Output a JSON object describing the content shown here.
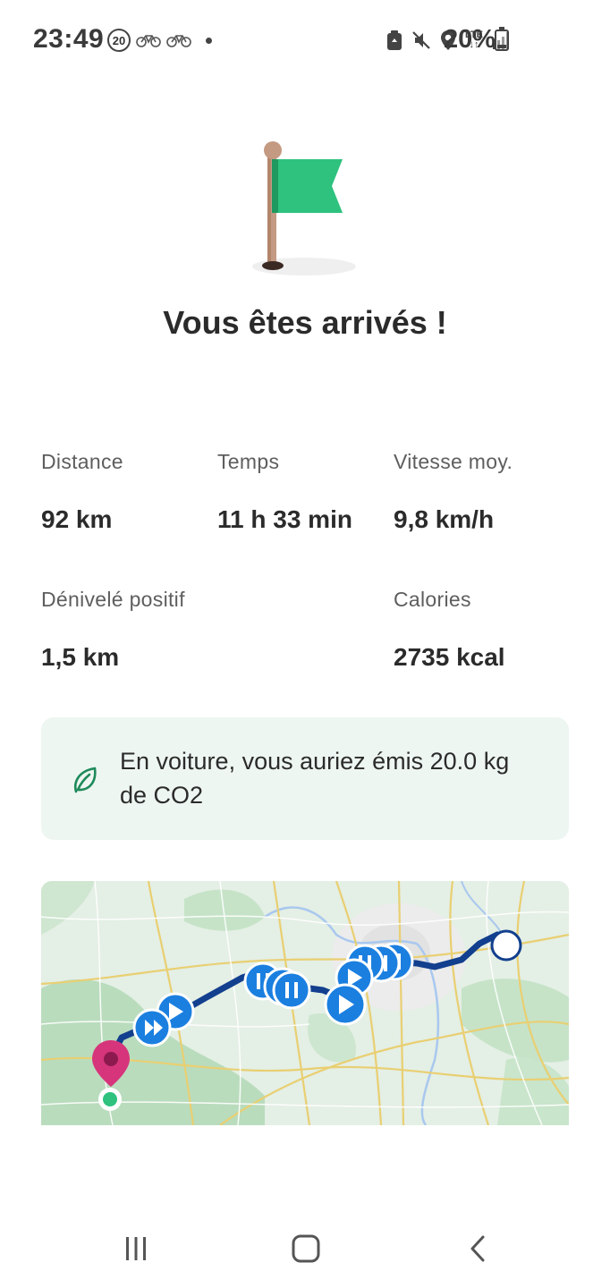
{
  "status_bar": {
    "time": "23:49",
    "notification_badge": "20",
    "battery": "20%",
    "battery_level": 0.2,
    "network": "LTE",
    "icons": [
      "bike-icon",
      "bike-icon",
      "recycle-icon",
      "mute-icon",
      "location-icon",
      "lte-icon",
      "signal-icon",
      "battery-icon"
    ]
  },
  "hero": {
    "title": "Vous êtes arrivés !",
    "icon": "flag-icon",
    "colors": {
      "flag": "#2ec27e",
      "flag_dark": "#1f9960",
      "pole": "#c49a82"
    }
  },
  "stats": {
    "distance": {
      "label": "Distance",
      "value": "92 km"
    },
    "time": {
      "label": "Temps",
      "value": "11 h 33 min"
    },
    "speed": {
      "label": "Vitesse moy.",
      "value": "9,8 km/h"
    },
    "elevation": {
      "label": "Dénivelé positif",
      "value": "1,5 km"
    },
    "calories": {
      "label": "Calories",
      "value": "2735 kcal"
    }
  },
  "co2": {
    "text": "En voiture, vous auriez émis 20.0 kg de CO2",
    "icon": "leaf-icon",
    "background": "#eef6f1",
    "icon_color": "#1e8a5a"
  },
  "map": {
    "route_color": "#123f8e",
    "marker_color": "#1b7fe0",
    "destination_color": "#d6357b",
    "start_color": "#2ec27e",
    "icons": [
      "play-icon",
      "fast-forward-icon",
      "pause-icon",
      "destination-pin-icon",
      "start-dot-icon"
    ]
  },
  "nav_bar": {
    "buttons": [
      "recent-apps-icon",
      "home-icon",
      "back-icon"
    ]
  }
}
